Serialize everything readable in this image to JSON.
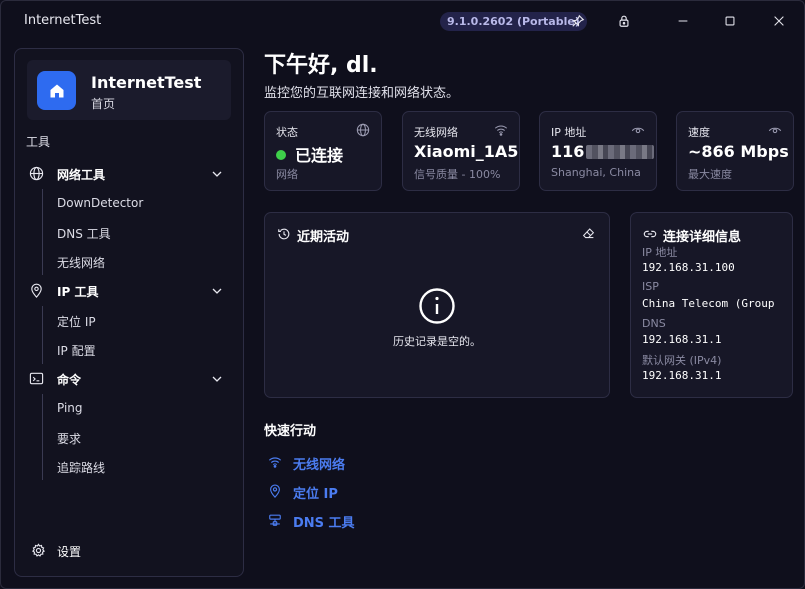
{
  "window": {
    "title": "InternetTest",
    "version": "9.1.0.2602 (Portable)"
  },
  "sidebar": {
    "app_name": "InternetTest",
    "app_sub": "首页",
    "section_label": "工具",
    "groups": [
      {
        "label": "网络工具",
        "icon": "globe-icon",
        "items": [
          "DownDetector",
          "DNS 工具",
          "无线网络"
        ]
      },
      {
        "label": "IP 工具",
        "icon": "location-pin-icon",
        "items": [
          "定位 IP",
          "IP 配置"
        ]
      },
      {
        "label": "命令",
        "icon": "terminal-icon",
        "items": [
          "Ping",
          "要求",
          "追踪路线"
        ]
      }
    ],
    "settings_label": "设置"
  },
  "main": {
    "greeting": "下午好, dl.",
    "subtitle": "监控您的互联网连接和网络状态。",
    "stats": {
      "status": {
        "label": "状态",
        "value": "已连接",
        "desc": "网络"
      },
      "wifi": {
        "label": "无线网络",
        "value": "Xiaomi_1A5",
        "desc": "信号质量 - 100%"
      },
      "ip": {
        "label": "IP 地址",
        "value": "116",
        "desc": "Shanghai, China"
      },
      "speed": {
        "label": "速度",
        "value": "~866 Mbps",
        "desc": "最大速度"
      }
    },
    "activity": {
      "title": "近期活动",
      "empty_text": "历史记录是空的。"
    },
    "details": {
      "title": "连接详细信息",
      "rows": [
        {
          "label": "IP 地址",
          "value": "192.168.31.100"
        },
        {
          "label": "ISP",
          "value": "China Telecom (Group"
        },
        {
          "label": "DNS",
          "value": "192.168.31.1"
        },
        {
          "label": "默认网关 (IPv4)",
          "value": "192.168.31.1"
        }
      ]
    },
    "quick_actions": {
      "title": "快速行动",
      "items": [
        "无线网络",
        "定位 IP",
        "DNS 工具"
      ]
    }
  },
  "colors": {
    "background": "#0f0f1c",
    "accent": "#2e6bf0",
    "link": "#4b7cf0",
    "connected": "#3ecf4a"
  }
}
